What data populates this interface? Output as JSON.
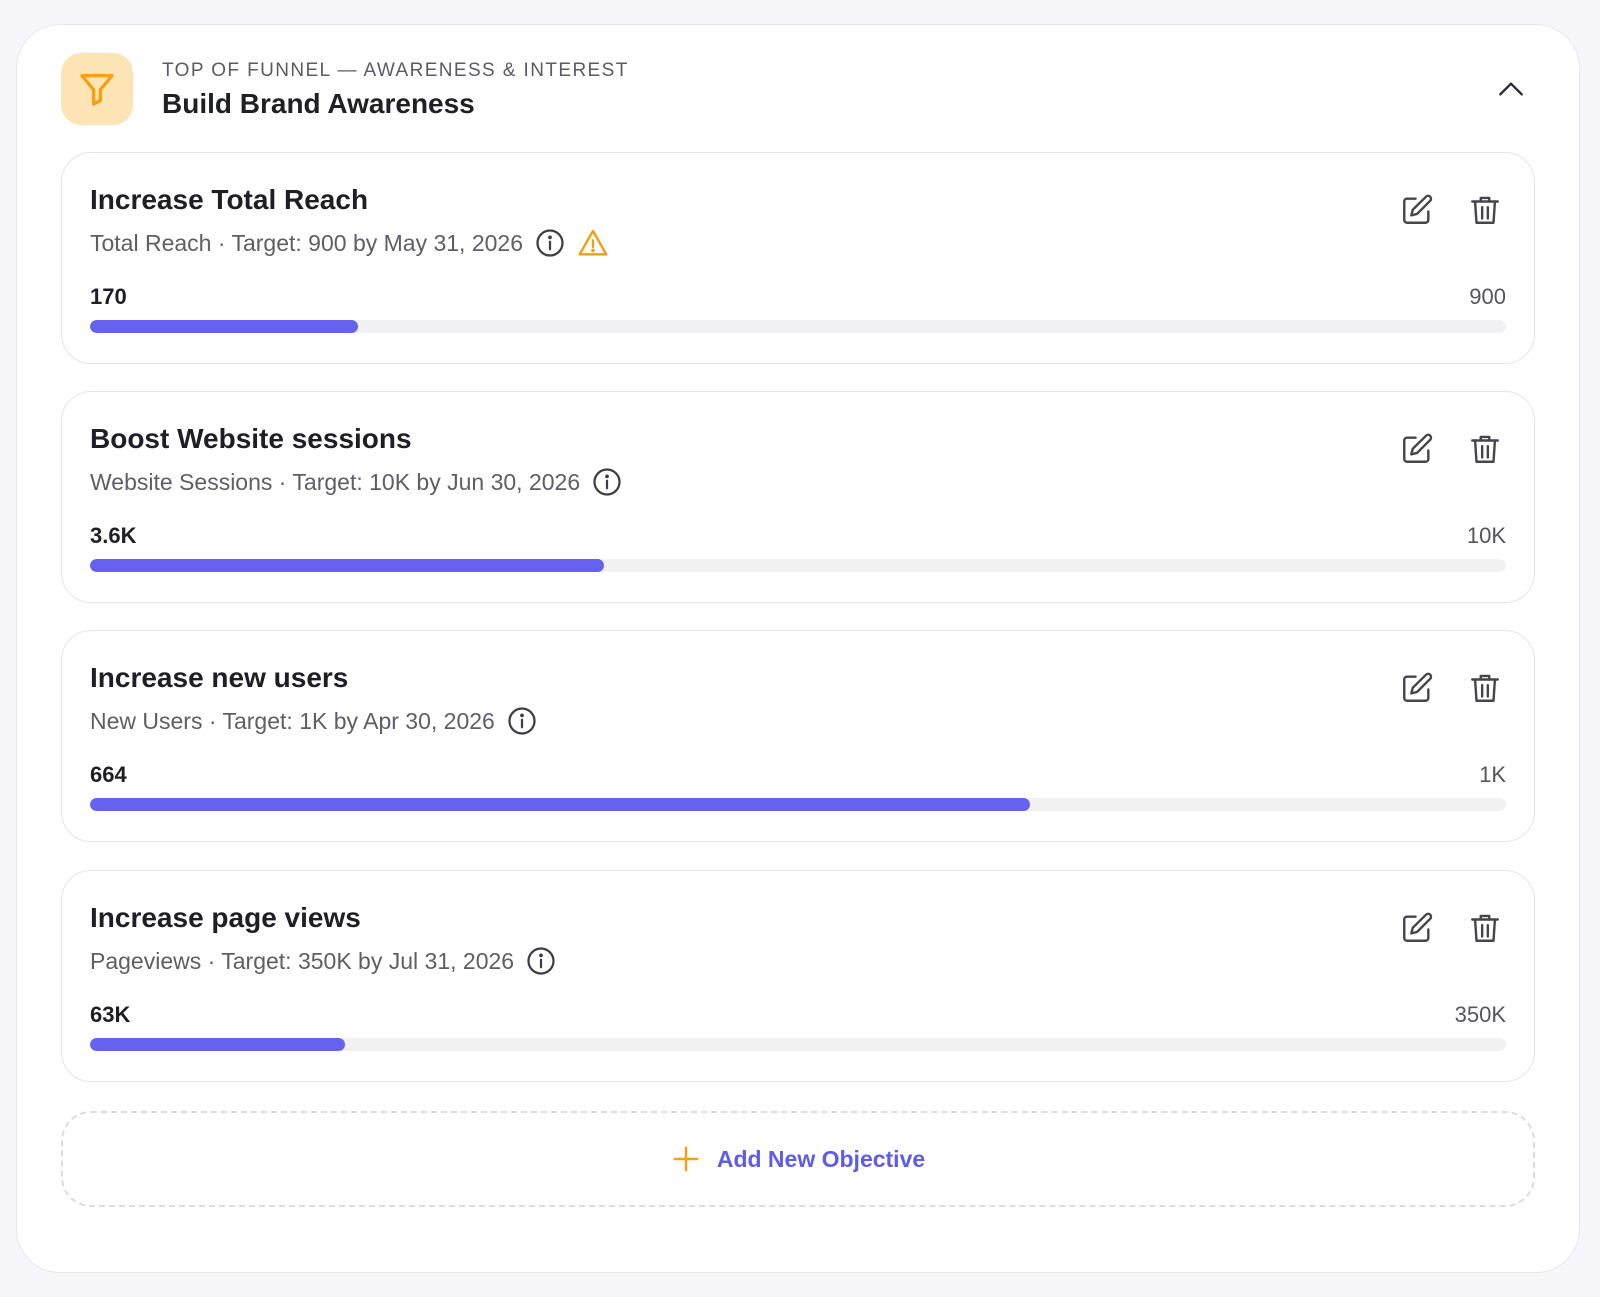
{
  "section": {
    "eyebrow": "TOP OF FUNNEL — AWARENESS & INTEREST",
    "title": "Build Brand Awareness",
    "icon": "funnel-icon",
    "collapse_icon": "chevron-up-icon"
  },
  "colors": {
    "accent": "#6562f0",
    "badge_bg": "#fde4b4",
    "badge_icon": "#f5a113",
    "warning": "#f0a00f",
    "track": "#f1f1f4"
  },
  "objectives": [
    {
      "title": "Increase Total Reach",
      "subtitle": "Total Reach · Target: 900 by May 31, 2026",
      "current": "170",
      "target": "900",
      "progress": 0.189,
      "warning": true
    },
    {
      "title": "Boost Website sessions",
      "subtitle": "Website Sessions · Target: 10K by Jun 30, 2026",
      "current": "3.6K",
      "target": "10K",
      "progress": 0.363,
      "warning": false
    },
    {
      "title": "Increase new users",
      "subtitle": "New Users · Target: 1K by Apr 30, 2026",
      "current": "664",
      "target": "1K",
      "progress": 0.664,
      "warning": false
    },
    {
      "title": "Increase page views",
      "subtitle": "Pageviews · Target: 350K by Jul 31, 2026",
      "current": "63K",
      "target": "350K",
      "progress": 0.18,
      "warning": false
    }
  ],
  "add_button": {
    "label": "Add New Objective",
    "icon": "plus-icon"
  }
}
